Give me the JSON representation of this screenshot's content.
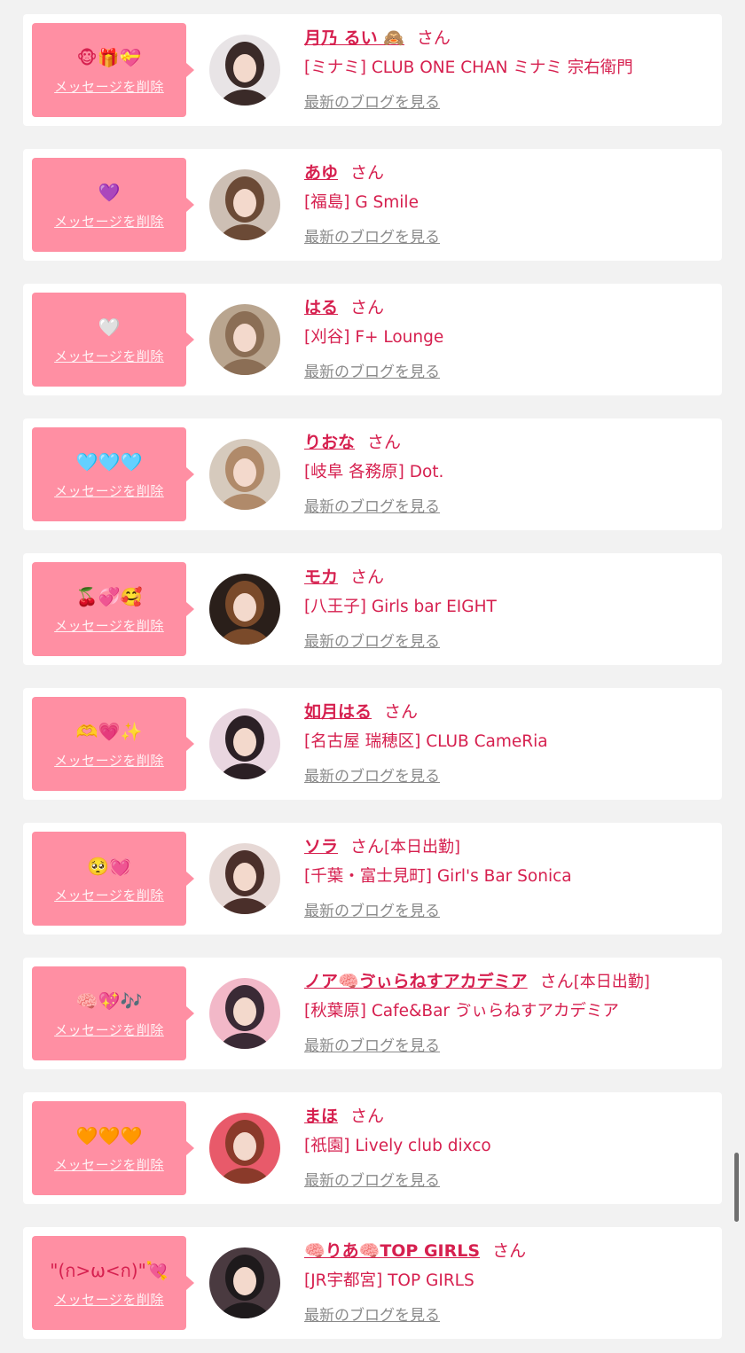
{
  "common": {
    "delete_label": "メッセージを削除",
    "blog_label": "最新のブログを見る",
    "san_label": "さん"
  },
  "colors": {
    "accent": "#d6204f",
    "bubble": "#ff8fa3",
    "card": "#ffffff",
    "background": "#f2f2f2",
    "link_gray": "#8a8a8a"
  },
  "items": [
    {
      "message": "🐵🎁💝",
      "name": "月乃 るい 🙈",
      "tag": "",
      "shop": "[ミナミ] CLUB ONE CHAN ミナミ 宗右衛門",
      "avatar_color": "#3a2a28",
      "avatar_bg": "#e8e4e6"
    },
    {
      "message": "💜",
      "name": "あゆ",
      "tag": "",
      "shop": "[福島] G Smile",
      "avatar_color": "#6b4a36",
      "avatar_bg": "#cdbfb4"
    },
    {
      "message": "🤍",
      "name": "はる",
      "tag": "",
      "shop": "[刈谷] F+ Lounge",
      "avatar_color": "#8b6e55",
      "avatar_bg": "#b9a58f"
    },
    {
      "message": "🩵🩵🩵",
      "name": "りおな",
      "tag": "",
      "shop": "[岐阜 各務原] Dot.",
      "avatar_color": "#b08a6a",
      "avatar_bg": "#d6cabd"
    },
    {
      "message": "🍒💞🥰",
      "name": "モカ",
      "tag": "",
      "shop": "[八王子] Girls bar EIGHT",
      "avatar_color": "#7a4a2a",
      "avatar_bg": "#2a1f1a"
    },
    {
      "message": "🫶💗✨",
      "name": "如月はる",
      "tag": "",
      "shop": "[名古屋 瑞穂区] CLUB CameRia",
      "avatar_color": "#2b2025",
      "avatar_bg": "#e9d6e0"
    },
    {
      "message": "🥺💓",
      "name": "ソラ",
      "tag": "[本日出勤]",
      "shop": "[千葉・富士見町] Girl's Bar Sonica",
      "avatar_color": "#4a2f2a",
      "avatar_bg": "#e6d8d5"
    },
    {
      "message": "🧠💖🎶",
      "name": "ノア🧠ゔぃらねすアカデミア",
      "tag": "[本日出勤]",
      "shop": "[秋葉原] Cafe&Bar ゔぃらねすアカデミア",
      "avatar_color": "#3a2a35",
      "avatar_bg": "#f2b8c8"
    },
    {
      "message": "🧡🧡🧡",
      "name": "まほ",
      "tag": "",
      "shop": "[祇園] Lively club dixco",
      "avatar_color": "#8a3a2a",
      "avatar_bg": "#e85a6a"
    },
    {
      "message": "\"(ก>ω<ก)\"💘",
      "name": "🧠りあ🧠TOP GIRLS",
      "tag": "",
      "shop": "[JR宇都宮] TOP GIRLS",
      "avatar_color": "#1e1a1c",
      "avatar_bg": "#4a3a40"
    }
  ]
}
